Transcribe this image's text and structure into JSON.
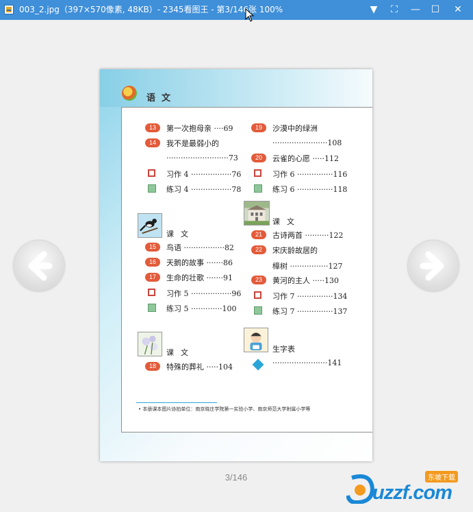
{
  "window": {
    "title": "003_2.jpg（397×570像素, 48KB）- 2345看图王 - 第3/146张 100%",
    "controls": {
      "dropdown": "▼",
      "fullscreen": "⛶",
      "minimize": "—",
      "maximize": "☐",
      "close": "✕"
    }
  },
  "book_page": {
    "subject": "语文",
    "units": [
      {
        "label": "课文",
        "icon": "magpie-image"
      },
      {
        "label": "课文",
        "icon": "flowers-image"
      },
      {
        "label": "课文",
        "icon": "house-image"
      },
      {
        "label": "生字表",
        "icon": "child-image"
      }
    ],
    "lessons": [
      {
        "num": "13",
        "text": "第一次抱母亲 ····69"
      },
      {
        "num": "14",
        "text": "我不是最弱小的",
        "cont": "··························73"
      },
      {
        "num": "15",
        "text": "鸟语 ·················82"
      },
      {
        "num": "16",
        "text": "天鹅的故事 ·······86"
      },
      {
        "num": "17",
        "text": "生命的壮歌 ·······91"
      },
      {
        "num": "18",
        "text": "特殊的葬礼 ·····104"
      },
      {
        "num": "19",
        "text": "沙漠中的绿洲",
        "cont": "·······················108"
      },
      {
        "num": "20",
        "text": "云雀的心愿 ·····112"
      },
      {
        "num": "21",
        "text": "古诗两首 ··········122"
      },
      {
        "num": "22",
        "text": "宋庆龄故居的",
        "cont": "樟树 ················127"
      },
      {
        "num": "23",
        "text": "黄河的主人 ·····130"
      }
    ],
    "exercises": [
      {
        "text": "习作 4 ·················76",
        "type": "composition"
      },
      {
        "text": "练习 4 ·················78",
        "type": "practice"
      },
      {
        "text": "习作 5 ·················96",
        "type": "composition"
      },
      {
        "text": "练习 5 ·············100",
        "type": "practice"
      },
      {
        "text": "习作 6 ···············116",
        "type": "composition"
      },
      {
        "text": "练习 6 ···············118",
        "type": "practice"
      },
      {
        "text": "习作 7 ···············134",
        "type": "composition"
      },
      {
        "text": "练习 7 ···············137",
        "type": "practice"
      }
    ],
    "glossary_pages": "·······················141",
    "footnote": "•   本册课本图片协拍单位：南京晓庄学院第一实验小学、南京师范大学附属小学等"
  },
  "viewer": {
    "page_counter": "3/146",
    "watermark": "uzzf.com",
    "watermark_badge": "东坡下载"
  },
  "colors": {
    "titlebar": "#3f8fd9",
    "lesson_badge": "#e35b3a",
    "accent_blue": "#2aa5d8"
  }
}
